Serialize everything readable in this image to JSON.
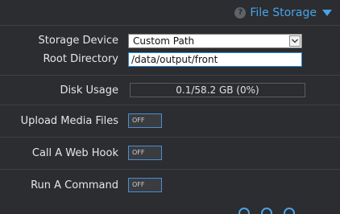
{
  "header": {
    "help_glyph": "?",
    "title": "File Storage"
  },
  "storage": {
    "device_label": "Storage Device",
    "device_value": "Custom Path",
    "root_label": "Root Directory",
    "root_value": "/data/output/front"
  },
  "disk": {
    "label": "Disk Usage",
    "value": "0.1/58.2 GB (0%)",
    "fraction": 0
  },
  "options": [
    {
      "label": "Upload Media Files",
      "state": "OFF"
    },
    {
      "label": "Call A Web Hook",
      "state": "OFF"
    },
    {
      "label": "Run A Command",
      "state": "OFF"
    }
  ],
  "colors": {
    "accent": "#4aa3e6",
    "background": "#2b2d30"
  }
}
